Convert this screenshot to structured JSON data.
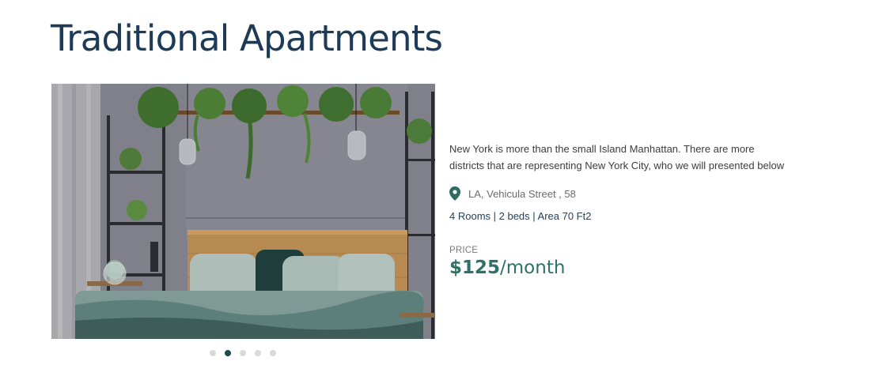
{
  "listing": {
    "title": "Traditional Apartments",
    "description": "New York is more than the small Island Manhattan. There are more districts that are representing New York City, who we will presented below",
    "location": "LA, Vehicula Street , 58",
    "features": "4 Rooms | 2 beds | Area 70 Ft2",
    "price_label": "PRICE",
    "price_amount": "$125",
    "price_period": "/month"
  },
  "carousel": {
    "slide_count": 5,
    "active_index": 1
  },
  "icons": {
    "location": "map-pin-icon"
  },
  "colors": {
    "title": "#1d3a57",
    "price": "#2f7068",
    "features": "#23405f",
    "dot_active": "#1e4b4b",
    "dot_inactive": "#d9dadb"
  }
}
